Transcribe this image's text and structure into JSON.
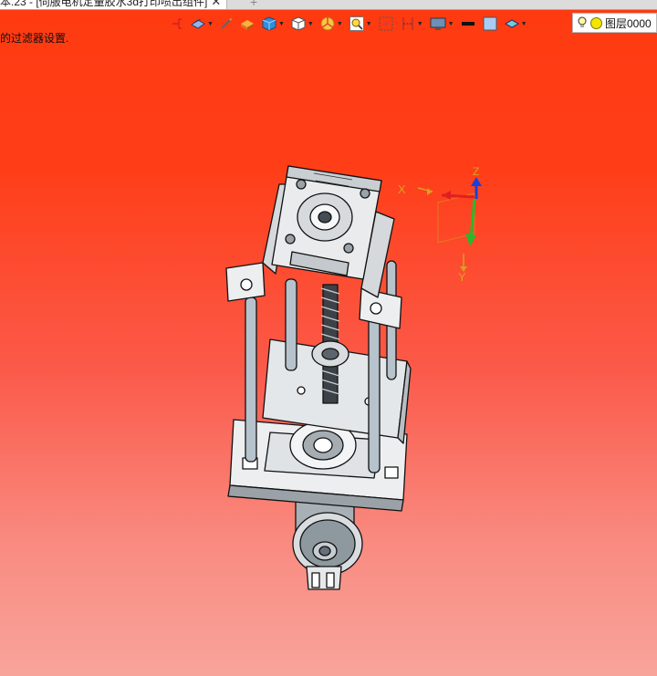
{
  "tab": {
    "title": "本.23 - [伺服电机定量胶水3d打印喷出组件]",
    "close_glyph": "✕",
    "new_tab_glyph": "+"
  },
  "toolbar": {
    "icons": [
      "view-origin-icon",
      "render-mode-icon",
      "measure-icon",
      "paint-icon",
      "shaded-cube-icon",
      "wireframe-cube-icon",
      "section-view-icon",
      "zoom-fit-icon",
      "zoom-window-icon",
      "clip-plane-icon",
      "display-icon",
      "line-color-icon",
      "fill-color-icon",
      "layer-style-icon"
    ],
    "layer_label": "图层0000"
  },
  "status": {
    "message": "的过滤器设置."
  },
  "triad": {
    "x_label": "X",
    "y_label": "Y",
    "z_label": "Z"
  },
  "colors": {
    "background_top": "#ff3a10",
    "background_bottom": "#f9a49b",
    "model_face": "#e6e8ea",
    "axis_x": "#e02020",
    "axis_y": "#2ab82a",
    "axis_z": "#1a40d8"
  }
}
